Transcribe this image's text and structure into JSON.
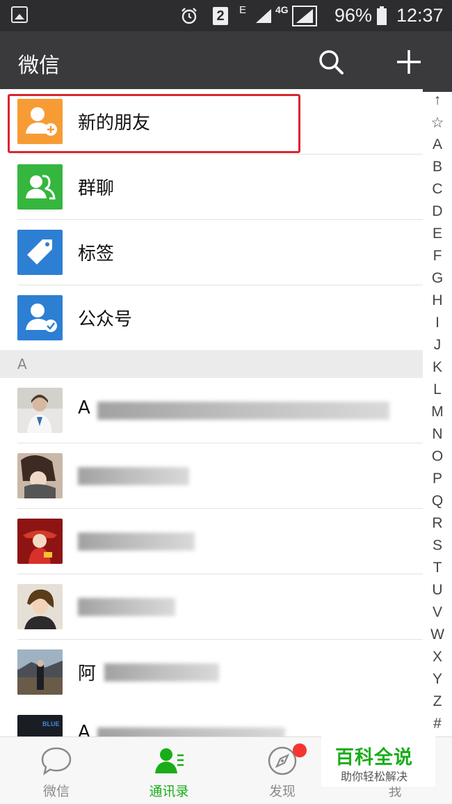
{
  "status_bar": {
    "sim_badge": "2",
    "network_e": "E",
    "network_4g": "4G",
    "battery": "96%",
    "time": "12:37"
  },
  "titlebar": {
    "title": "微信",
    "search_icon": "search-icon",
    "add_icon": "plus-icon"
  },
  "fixed_entries": [
    {
      "label": "新的朋友",
      "icon": "new-friend-icon",
      "color": "#f79c35"
    },
    {
      "label": "群聊",
      "icon": "group-chat-icon",
      "color": "#35b63e"
    },
    {
      "label": "标签",
      "icon": "tag-icon",
      "color": "#2d7fd4"
    },
    {
      "label": "公众号",
      "icon": "official-account-icon",
      "color": "#2d7fd4"
    }
  ],
  "section": {
    "letter": "A"
  },
  "contacts": [
    {
      "label": "A",
      "avatar": "avatar-photo"
    },
    {
      "label": "",
      "avatar": "avatar-photo"
    },
    {
      "label": "",
      "avatar": "avatar-photo"
    },
    {
      "label": "",
      "avatar": "avatar-photo"
    },
    {
      "label": "阿",
      "avatar": "avatar-photo"
    },
    {
      "label": "A",
      "avatar": "avatar-photo"
    }
  ],
  "index_letters": [
    "↑",
    "☆",
    "A",
    "B",
    "C",
    "D",
    "E",
    "F",
    "G",
    "H",
    "I",
    "J",
    "K",
    "L",
    "M",
    "N",
    "O",
    "P",
    "Q",
    "R",
    "S",
    "T",
    "U",
    "V",
    "W",
    "X",
    "Y",
    "Z",
    "#"
  ],
  "tabs": [
    {
      "label": "微信",
      "icon": "chat-bubble-icon",
      "active": false
    },
    {
      "label": "通讯录",
      "icon": "contacts-icon",
      "active": true
    },
    {
      "label": "发现",
      "icon": "compass-icon",
      "active": false
    },
    {
      "label": "我",
      "icon": "profile-icon",
      "active": false
    }
  ],
  "watermark": {
    "title": "百科全说",
    "subtitle": "助你轻松解决"
  },
  "colors": {
    "accent_green": "#1aad19",
    "highlight_red": "#d9262d",
    "titlebar": "#3a3a3c"
  }
}
